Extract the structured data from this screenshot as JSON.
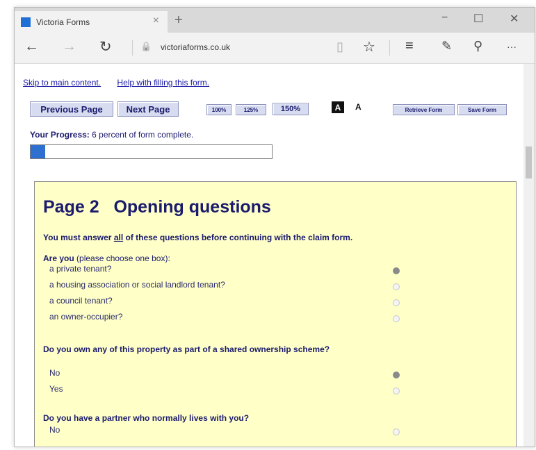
{
  "browser": {
    "tab_title": "Victoria Forms",
    "url": "victoriaforms.co.uk",
    "icons": {
      "close": "×",
      "new_tab": "+",
      "minimize": "−",
      "maximize": "☐",
      "window_close": "✕",
      "back": "←",
      "forward": "→",
      "refresh": "↻",
      "lock": "🔒",
      "reading_view": "▯",
      "favorite": "☆",
      "hub": "≡",
      "notes": "✎",
      "share": "⚲",
      "more": "···"
    },
    "favicon_color": "#1e6fd6"
  },
  "page": {
    "skip_link": "Skip to main content.",
    "help_link": "Help with filling this form.",
    "buttons": {
      "previous": "Previous Page",
      "next": "Next Page",
      "zoom_100": "100%",
      "zoom_125": "125%",
      "zoom_150": "150%",
      "contrast_dark": "A",
      "contrast_light": "A",
      "retrieve": "Retrieve Form",
      "save": "Save Form"
    },
    "progress": {
      "label": "Your Progress:",
      "text": "6 percent of form complete.",
      "percent": 6
    },
    "form": {
      "title": "Page 2   Opening questions",
      "intro_pre": "You must answer ",
      "intro_em": "all",
      "intro_post": " of these questions before continuing with the claim form.",
      "questions": [
        {
          "heading_bold": "Are you",
          "heading_rest": " (please choose one box):",
          "options": [
            {
              "label": "a private tenant?",
              "checked": true
            },
            {
              "label": "a housing association or social landlord tenant?",
              "checked": false
            },
            {
              "label": "a council tenant?",
              "checked": false
            },
            {
              "label": "an owner-occupier?",
              "checked": false
            }
          ]
        },
        {
          "heading_bold": "Do you own any of this property as part of a shared ownership scheme?",
          "heading_rest": "",
          "options": [
            {
              "label": "No",
              "checked": true
            },
            {
              "label": "Yes",
              "checked": false
            }
          ]
        },
        {
          "heading_bold": "Do you have a partner who normally lives with you?",
          "heading_rest": "",
          "options": [
            {
              "label": "No",
              "checked": false
            }
          ]
        }
      ]
    },
    "colors": {
      "form_background": "#ffffc8",
      "heading_text": "#1b1b6e",
      "button_background": "#d7dcf0",
      "progress_fill": "#2f6fd0",
      "link": "#1a1aa6"
    }
  }
}
